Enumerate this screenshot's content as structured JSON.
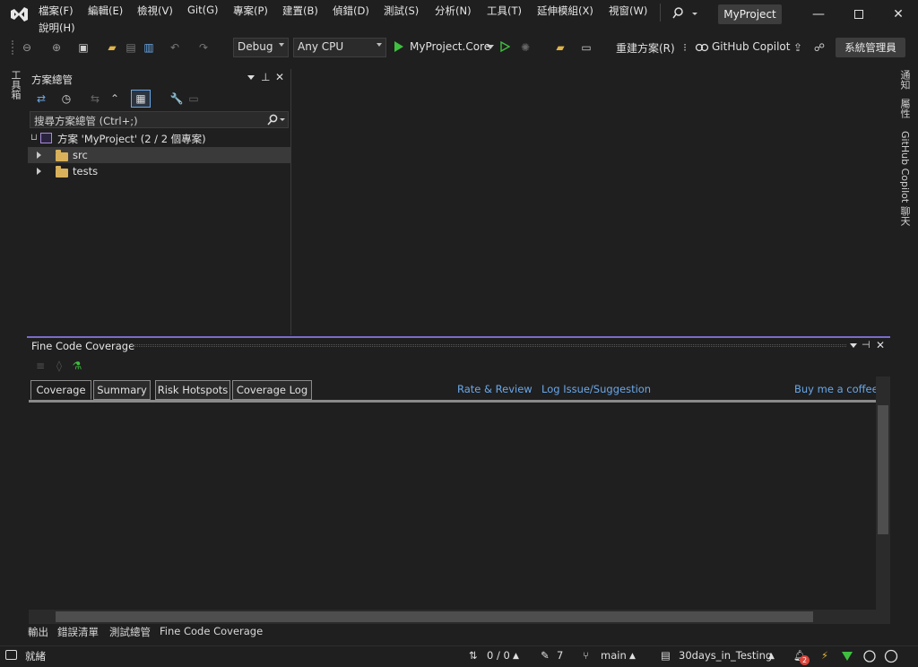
{
  "menu": {
    "items": [
      "檔案(F)",
      "編輯(E)",
      "檢視(V)",
      "Git(G)",
      "專案(P)",
      "建置(B)",
      "偵錯(D)",
      "測試(S)",
      "分析(N)",
      "工具(T)",
      "延伸模組(X)",
      "視窗(W)"
    ],
    "help": "說明(H)"
  },
  "title": {
    "project": "MyProject"
  },
  "toolbar": {
    "config": "Debug",
    "platform": "Any CPU",
    "startup": "MyProject.Core",
    "rebuild": "重建方案(R)",
    "copilot": "GitHub Copilot",
    "admin": "系統管理員"
  },
  "left_strip": {
    "toolbox": "工具箱"
  },
  "right_strip": {
    "notifications": "通知",
    "properties": "屬性",
    "copilot_chat": "GitHub Copilot 聊天"
  },
  "solution_explorer": {
    "title": "方案總管",
    "search_placeholder": "搜尋方案總管 (Ctrl+;)",
    "solution_label": "方案 'MyProject' (2 / 2 個專案)",
    "items": [
      {
        "label": "src",
        "selected": true
      },
      {
        "label": "tests",
        "selected": false
      }
    ]
  },
  "coverage": {
    "title": "Fine Code Coverage",
    "tabs": [
      "Coverage",
      "Summary",
      "Risk Hotspots",
      "Coverage Log"
    ],
    "active_tab": "Coverage",
    "links": {
      "rate": "Rate & Review",
      "log_issue": "Log Issue/Suggestion",
      "coffee": "Buy me a coffee"
    }
  },
  "bottom_tabs": [
    "輸出",
    "錯誤清單",
    "測試總管",
    "Fine Code Coverage"
  ],
  "status": {
    "ready": "就緒",
    "changes": "0 / 0",
    "pending": "7",
    "branch": "main",
    "repo": "30days_in_Testing",
    "notifications": "2"
  },
  "colors": {
    "accent": "#7a6ccf",
    "link": "#6aa7e8",
    "folder": "#d8b15a",
    "run": "#3fbf3f"
  }
}
